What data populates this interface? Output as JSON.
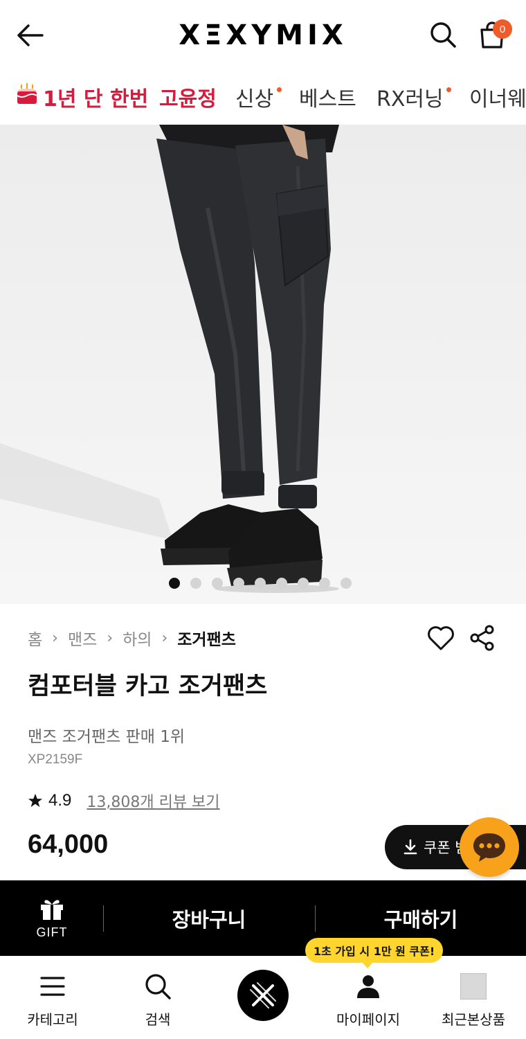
{
  "header": {
    "logo": "XΞXYMIX",
    "cart_count": "0",
    "icons": {
      "back": "back-arrow-icon",
      "search": "search-icon",
      "cart": "shopping-bag-icon"
    }
  },
  "category_nav": {
    "items": [
      {
        "label": "1년 단 한번",
        "highlight": true,
        "icon": "cake-icon"
      },
      {
        "label": "고윤정",
        "highlight": true
      },
      {
        "label": "신상",
        "new_dot": true
      },
      {
        "label": "베스트"
      },
      {
        "label": "RX러닝",
        "new_dot": true
      },
      {
        "label": "이너웨어"
      }
    ]
  },
  "gallery": {
    "image": "product photo: model wearing black cargo jogger pants and black sneakers",
    "slide_count": 9,
    "active_slide": 1
  },
  "product": {
    "breadcrumb": [
      "홈",
      "맨즈",
      "하의",
      "조거팬츠"
    ],
    "title": "컴포터블 카고 조거팬츠",
    "subtitle": "맨즈 조거팬츠 판매 1위",
    "code": "XP2159F",
    "rating": "4.9",
    "reviews_link": "13,808개 리뷰 보기",
    "price": "64,000",
    "coupon_label": "쿠폰 받기"
  },
  "buy_bar": {
    "gift_label": "GIFT",
    "cart_label": "장바구니",
    "buy_label": "구매하기"
  },
  "bottom_nav": {
    "promo": "1초 가입 시 1만 원 쿠폰!",
    "items": [
      {
        "label": "카테고리",
        "icon": "menu-icon"
      },
      {
        "label": "검색",
        "icon": "search-icon"
      },
      {
        "label": "",
        "icon": "xexymix-logo-icon"
      },
      {
        "label": "마이페이지",
        "icon": "person-icon"
      },
      {
        "label": "최근본상품",
        "icon": "recent-thumbnail-icon"
      }
    ]
  },
  "colors": {
    "accent_red": "#d81b3c",
    "badge_orange": "#f15a29",
    "chat_yellow": "#f7a21a",
    "promo_yellow": "#ffd52e"
  }
}
